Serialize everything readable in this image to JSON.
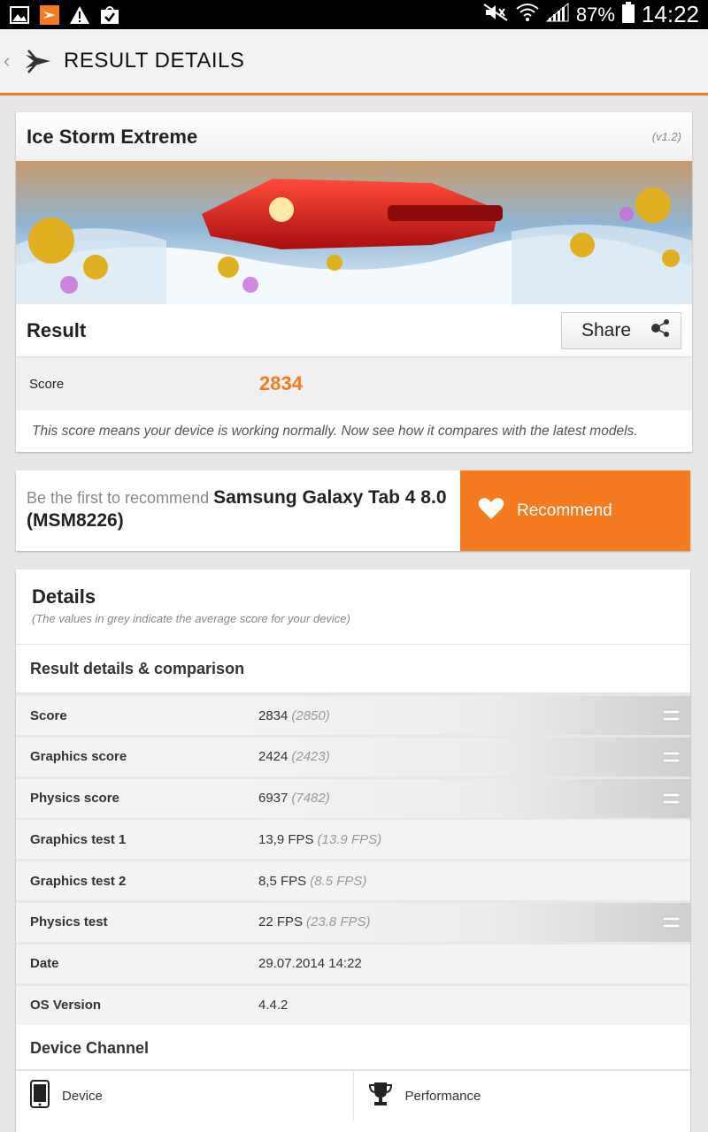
{
  "status_bar": {
    "battery": "87%",
    "time": "14:22"
  },
  "action_bar": {
    "back_glyph": "‹",
    "title": "RESULT DETAILS"
  },
  "test": {
    "name": "Ice Storm Extreme",
    "version": "(v1.2)",
    "result_label": "Result",
    "share_label": "Share",
    "score_label": "Score",
    "score_value": "2834",
    "description": "This score means your device is working normally. Now see how it compares with the latest models."
  },
  "recommend": {
    "prefix": "Be the first to recommend",
    "device": "Samsung Galaxy Tab 4 8.0 (MSM8226)",
    "button_label": "Recommend"
  },
  "details": {
    "title": "Details",
    "subtitle": "(The values in grey indicate the average score for your device)",
    "section_title": "Result details & comparison",
    "rows": [
      {
        "label": "Score",
        "value": "2834",
        "avg": "(2850)"
      },
      {
        "label": "Graphics score",
        "value": "2424",
        "avg": "(2423)"
      },
      {
        "label": "Physics score",
        "value": "6937",
        "avg": "(7482)"
      },
      {
        "label": "Graphics test 1",
        "value": "13,9 FPS",
        "avg": "(13.9 FPS)"
      },
      {
        "label": "Graphics test 2",
        "value": "8,5 FPS",
        "avg": "(8.5 FPS)"
      },
      {
        "label": "Physics test",
        "value": "22 FPS",
        "avg": "(23.8 FPS)"
      },
      {
        "label": "Date",
        "value": "29.07.2014 14:22",
        "avg": ""
      },
      {
        "label": "OS Version",
        "value": "4.4.2",
        "avg": ""
      }
    ],
    "channel_title": "Device Channel",
    "tabs": [
      {
        "label": "Device",
        "icon": "phone-icon"
      },
      {
        "label": "Performance",
        "icon": "trophy-icon"
      }
    ]
  },
  "colors": {
    "accent": "#f47b20"
  }
}
